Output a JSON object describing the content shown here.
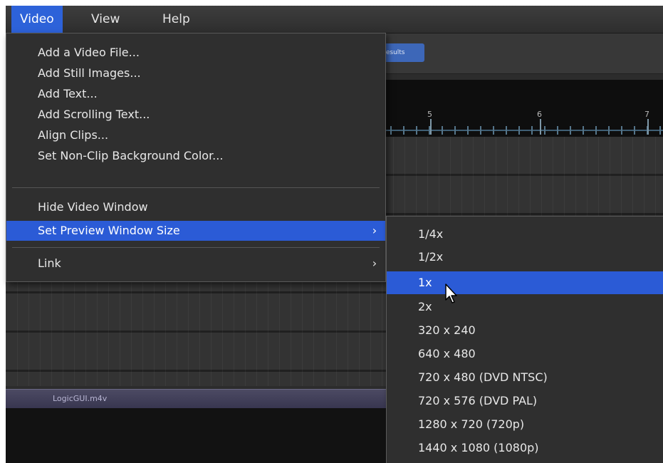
{
  "menubar": {
    "items": [
      {
        "label": "Video",
        "active": true
      },
      {
        "label": "View",
        "active": false
      },
      {
        "label": "Help",
        "active": false
      }
    ]
  },
  "toolbar": {
    "button_label": "Results"
  },
  "ruler": {
    "labels": [
      "5",
      "6",
      "7"
    ]
  },
  "clip": {
    "filename": "LogicGUI.m4v"
  },
  "video_menu": {
    "items": [
      {
        "label": "Add a Video File...",
        "submenu": false,
        "highlighted": false
      },
      {
        "label": "Add Still Images...",
        "submenu": false,
        "highlighted": false
      },
      {
        "label": "Add Text...",
        "submenu": false,
        "highlighted": false
      },
      {
        "label": "Add Scrolling Text...",
        "submenu": false,
        "highlighted": false
      },
      {
        "label": "Align Clips...",
        "submenu": false,
        "highlighted": false
      },
      {
        "label": "Set Non-Clip Background Color...",
        "submenu": false,
        "highlighted": false
      },
      {
        "label": "Hide Video Window",
        "submenu": false,
        "highlighted": false
      },
      {
        "label": "Set Preview Window Size",
        "submenu": true,
        "highlighted": true
      },
      {
        "label": "Link",
        "submenu": true,
        "highlighted": false
      }
    ]
  },
  "preview_size_submenu": {
    "items": [
      {
        "label": "1/4x",
        "highlighted": false
      },
      {
        "label": "1/2x",
        "highlighted": false
      },
      {
        "label": "1x",
        "highlighted": true
      },
      {
        "label": "2x",
        "highlighted": false
      },
      {
        "label": "320 x 240",
        "highlighted": false
      },
      {
        "label": "640 x 480",
        "highlighted": false
      },
      {
        "label": "720 x 480 (DVD NTSC)",
        "highlighted": false
      },
      {
        "label": "720 x 576 (DVD PAL)",
        "highlighted": false
      },
      {
        "label": "1280 x 720 (720p)",
        "highlighted": false
      },
      {
        "label": "1440 x 1080 (1080p)",
        "highlighted": false
      }
    ]
  },
  "icons": {
    "chevron": "chevron-right-icon",
    "cursor": "mouse-cursor-icon"
  },
  "colors": {
    "highlight": "#2b5bd6",
    "menu_background": "#2f2f2f",
    "text": "#e8e8e8"
  }
}
